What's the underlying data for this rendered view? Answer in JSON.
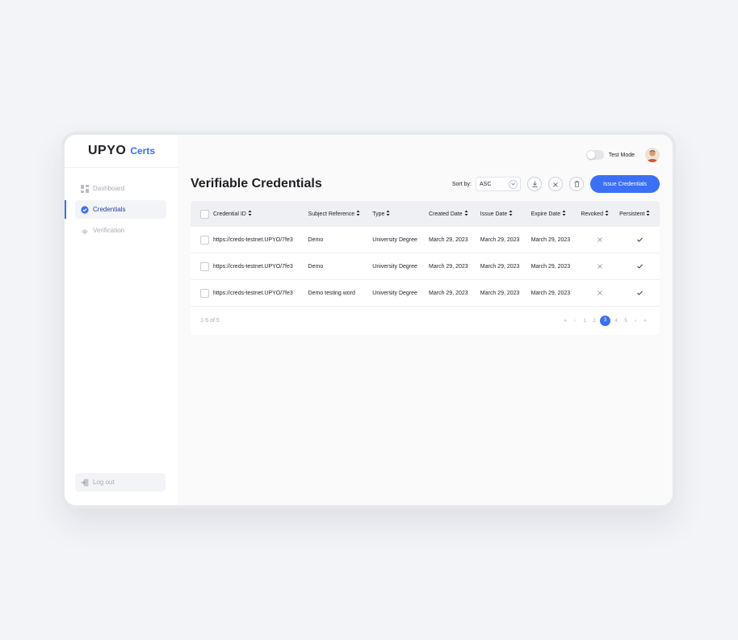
{
  "app": {
    "logo": "UPYO",
    "product": "Certs"
  },
  "sidebar": {
    "items": [
      {
        "label": "Dashboard",
        "icon": "grid-icon"
      },
      {
        "label": "Credentials",
        "icon": "badge-icon"
      },
      {
        "label": "Verification",
        "icon": "fingerprint-icon"
      }
    ],
    "logout_label": "Log out"
  },
  "header": {
    "test_mode_label": "Test Mode"
  },
  "page": {
    "title": "Verifiable Credentials",
    "sort_label": "Sort by:",
    "sort_value": "ASC",
    "issue_button": "Issue Credentials"
  },
  "table": {
    "columns": [
      "Credential ID",
      "Subject Reference",
      "Type",
      "Created Date",
      "Issue Date",
      "Expire Date",
      "Revoked",
      "Persistent"
    ],
    "rows": [
      {
        "id": "https://creds-testnet.UPYO/7fe3",
        "subject": "Demo",
        "type": "University Degree",
        "created": "March 29, 2023",
        "issue": "March 29, 2023",
        "expire": "March 29, 2023",
        "revoked": "x",
        "persistent": "check"
      },
      {
        "id": "https://creds-testnet.UPYO/7fe3",
        "subject": "Demo",
        "type": "University Degree",
        "created": "March 29, 2023",
        "issue": "March 29, 2023",
        "expire": "March 29, 2023",
        "revoked": "x",
        "persistent": "check"
      },
      {
        "id": "https://creds-testnet.UPYO/7fe3",
        "subject": "Demo testing word",
        "type": "University Degree",
        "created": "March 29, 2023",
        "issue": "March 29, 2023",
        "expire": "March 29, 2023",
        "revoked": "x",
        "persistent": "check"
      }
    ],
    "count_text": "1-5 of 5",
    "pages": [
      "1",
      "2",
      "3",
      "4",
      "5"
    ],
    "current_page": "3"
  },
  "colors": {
    "accent": "#3b6ff5",
    "background": "#f3f4f7"
  }
}
